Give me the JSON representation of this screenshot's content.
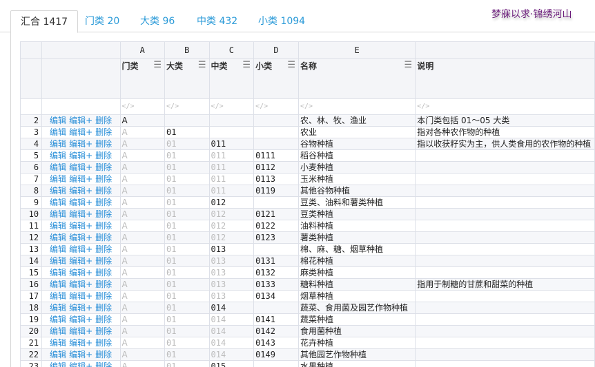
{
  "tabs": [
    {
      "label": "汇合 1417",
      "active": true
    },
    {
      "label": "门类 20",
      "active": false
    },
    {
      "label": "大类 96",
      "active": false
    },
    {
      "label": "中类 432",
      "active": false
    },
    {
      "label": "小类 1094",
      "active": false
    }
  ],
  "slogan": "梦寐以求·锦绣河山",
  "columns": {
    "letters": [
      "A",
      "B",
      "C",
      "D",
      "E",
      ""
    ],
    "names": [
      "门类",
      "大类",
      "中类",
      "小类",
      "名称",
      "说明"
    ],
    "filter_icon": "</>",
    "menu_icon": "☰"
  },
  "actions": {
    "edit": "编辑",
    "edit_plus": "编辑+",
    "delete": "删除"
  },
  "rows": [
    {
      "num": "2",
      "A": "A",
      "B": "",
      "C": "",
      "D": "",
      "name": "农、林、牧、渔业",
      "desc": "本门类包括 01～05 大类",
      "level": "A"
    },
    {
      "num": "3",
      "A": "A",
      "B": "01",
      "C": "",
      "D": "",
      "name": "农业",
      "desc": "指对各种农作物的种植",
      "level": "B"
    },
    {
      "num": "4",
      "A": "A",
      "B": "01",
      "C": "011",
      "D": "",
      "name": "谷物种植",
      "desc": "指以收获籽实为主，供人类食用的农作物的种植",
      "level": "C"
    },
    {
      "num": "5",
      "A": "A",
      "B": "01",
      "C": "011",
      "D": "0111",
      "name": "稻谷种植",
      "desc": "",
      "level": "D"
    },
    {
      "num": "6",
      "A": "A",
      "B": "01",
      "C": "011",
      "D": "0112",
      "name": "小麦种植",
      "desc": "",
      "level": "D"
    },
    {
      "num": "7",
      "A": "A",
      "B": "01",
      "C": "011",
      "D": "0113",
      "name": "玉米种植",
      "desc": "",
      "level": "D"
    },
    {
      "num": "8",
      "A": "A",
      "B": "01",
      "C": "011",
      "D": "0119",
      "name": "其他谷物种植",
      "desc": "",
      "level": "D"
    },
    {
      "num": "9",
      "A": "A",
      "B": "01",
      "C": "012",
      "D": "",
      "name": "豆类、油料和薯类种植",
      "desc": "",
      "level": "C"
    },
    {
      "num": "10",
      "A": "A",
      "B": "01",
      "C": "012",
      "D": "0121",
      "name": "豆类种植",
      "desc": "",
      "level": "D"
    },
    {
      "num": "11",
      "A": "A",
      "B": "01",
      "C": "012",
      "D": "0122",
      "name": "油料种植",
      "desc": "",
      "level": "D"
    },
    {
      "num": "12",
      "A": "A",
      "B": "01",
      "C": "012",
      "D": "0123",
      "name": "薯类种植",
      "desc": "",
      "level": "D"
    },
    {
      "num": "13",
      "A": "A",
      "B": "01",
      "C": "013",
      "D": "",
      "name": "棉、麻、糖、烟草种植",
      "desc": "",
      "level": "C"
    },
    {
      "num": "14",
      "A": "A",
      "B": "01",
      "C": "013",
      "D": "0131",
      "name": "棉花种植",
      "desc": "",
      "level": "D"
    },
    {
      "num": "15",
      "A": "A",
      "B": "01",
      "C": "013",
      "D": "0132",
      "name": "麻类种植",
      "desc": "",
      "level": "D"
    },
    {
      "num": "16",
      "A": "A",
      "B": "01",
      "C": "013",
      "D": "0133",
      "name": "糖料种植",
      "desc": "指用于制糖的甘蔗和甜菜的种植",
      "level": "D"
    },
    {
      "num": "17",
      "A": "A",
      "B": "01",
      "C": "013",
      "D": "0134",
      "name": "烟草种植",
      "desc": "",
      "level": "D"
    },
    {
      "num": "18",
      "A": "A",
      "B": "01",
      "C": "014",
      "D": "",
      "name": "蔬菜、食用菌及园艺作物种植",
      "desc": "",
      "level": "C"
    },
    {
      "num": "19",
      "A": "A",
      "B": "01",
      "C": "014",
      "D": "0141",
      "name": "蔬菜种植",
      "desc": "",
      "level": "D"
    },
    {
      "num": "20",
      "A": "A",
      "B": "01",
      "C": "014",
      "D": "0142",
      "name": "食用菌种植",
      "desc": "",
      "level": "D"
    },
    {
      "num": "21",
      "A": "A",
      "B": "01",
      "C": "014",
      "D": "0143",
      "name": "花卉种植",
      "desc": "",
      "level": "D"
    },
    {
      "num": "22",
      "A": "A",
      "B": "01",
      "C": "014",
      "D": "0149",
      "name": "其他园艺作物种植",
      "desc": "",
      "level": "D"
    },
    {
      "num": "23",
      "A": "A",
      "B": "01",
      "C": "015",
      "D": "",
      "name": "水果种植",
      "desc": "",
      "level": "C"
    }
  ]
}
